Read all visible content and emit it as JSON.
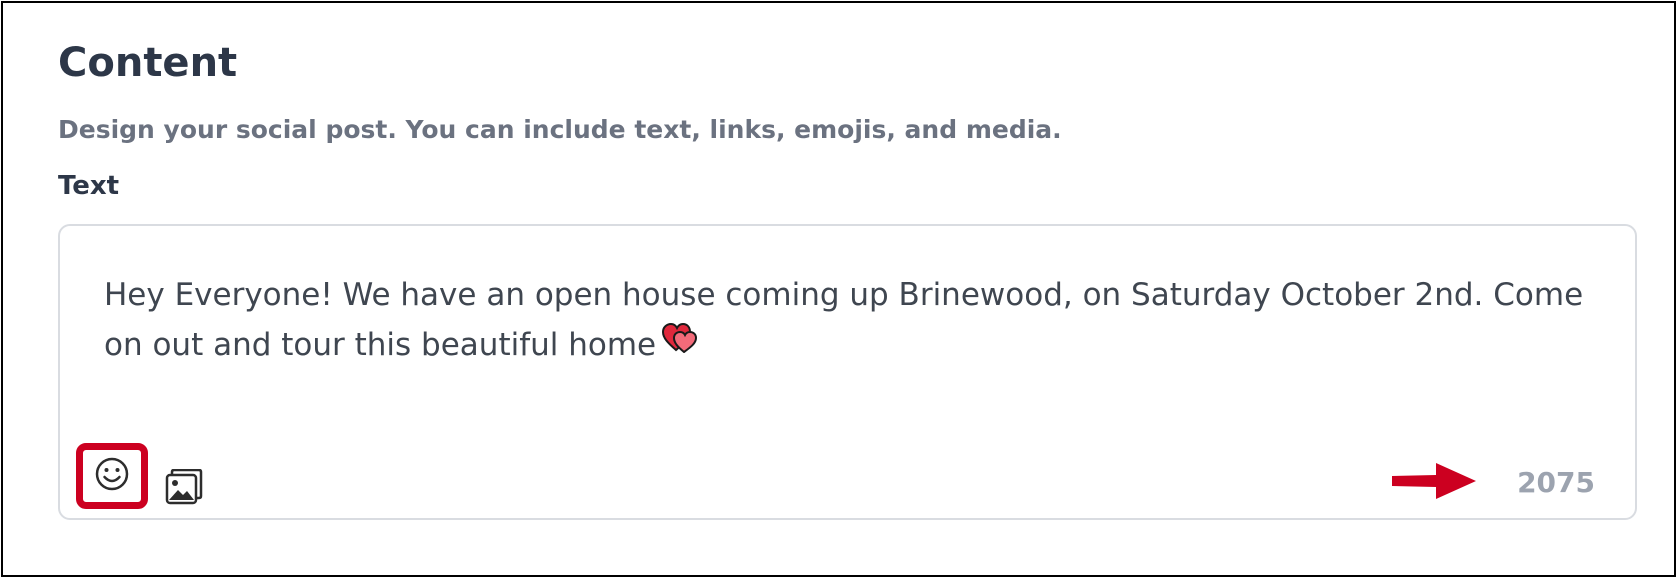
{
  "section": {
    "title": "Content",
    "subtitle": "Design your social post. You can include text, links, emojis, and media."
  },
  "text_field": {
    "label": "Text",
    "value": "Hey Everyone! We have an open house coming up Brinewood, on Saturday October 2nd. Come on out and tour this beautiful home",
    "emoji_in_text": "two-hearts",
    "char_count": "2075"
  },
  "toolbar": {
    "emoji_button_icon": "smiley-face-icon",
    "media_button_icon": "image-gallery-icon"
  },
  "annotations": {
    "highlight_color": "#cc0020",
    "arrow_color": "#cc0020"
  }
}
